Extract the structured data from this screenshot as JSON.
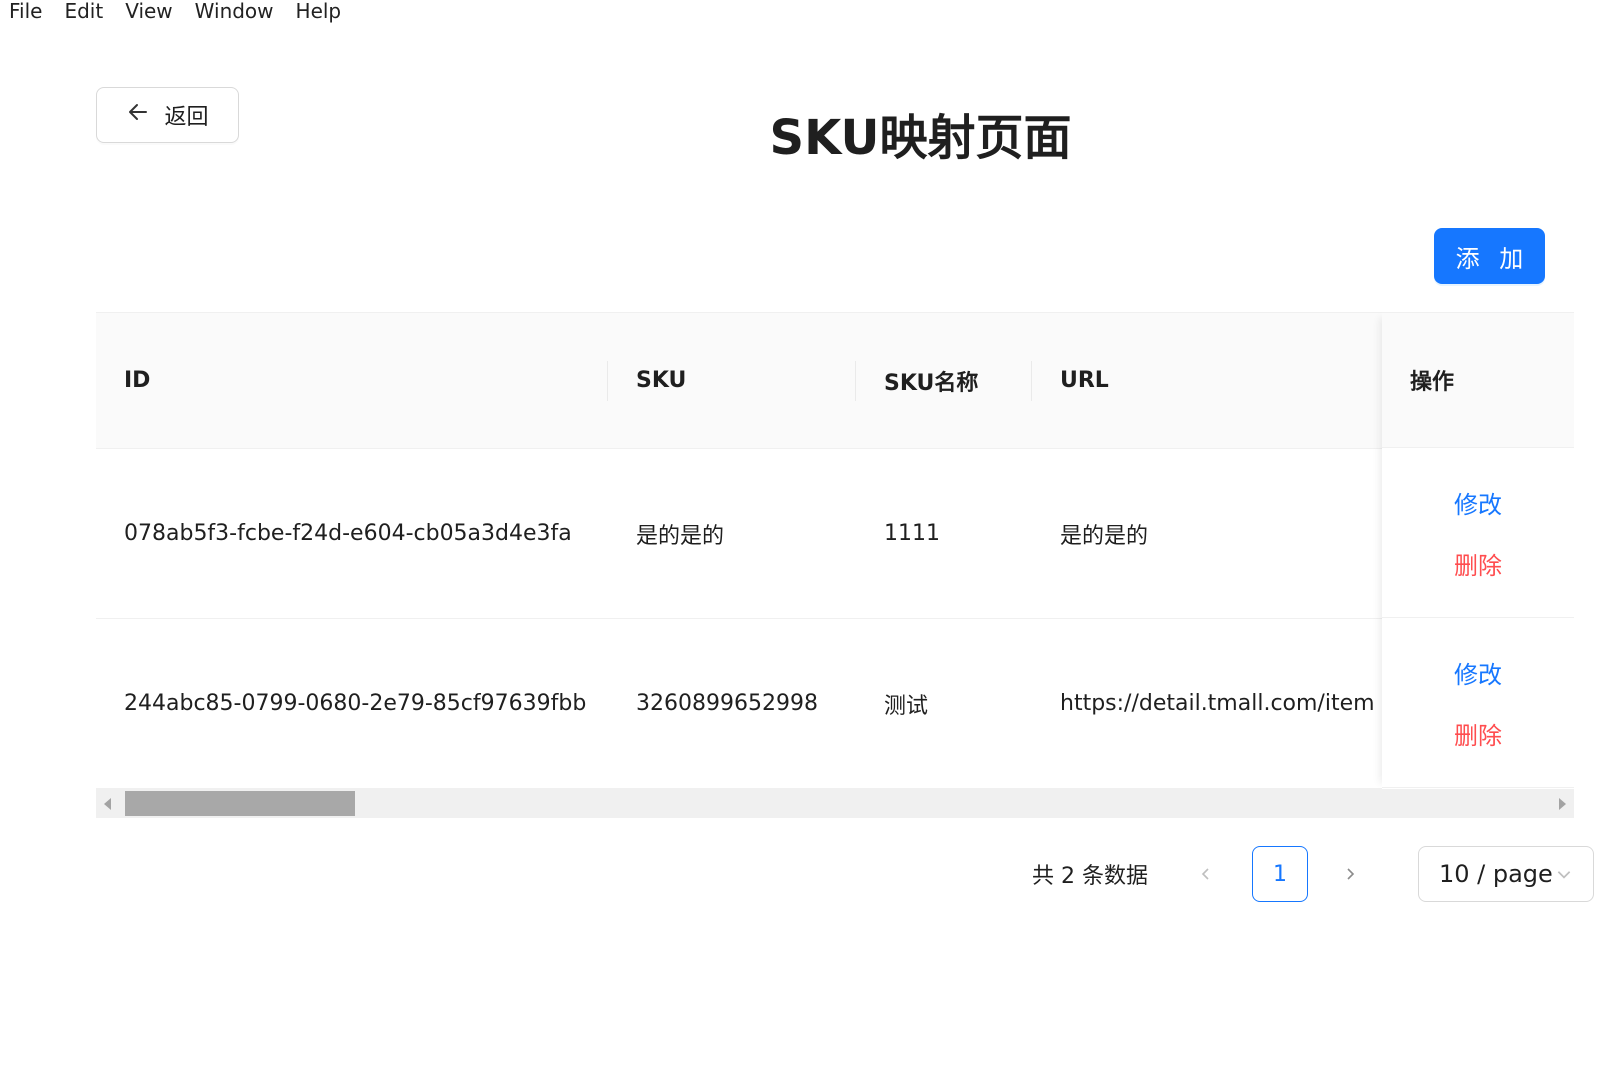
{
  "menubar": {
    "items": [
      "File",
      "Edit",
      "View",
      "Window",
      "Help"
    ]
  },
  "header": {
    "back_label": "返回",
    "title": "SKU映射页面"
  },
  "toolbar": {
    "add_label": "添 加"
  },
  "table": {
    "columns": [
      "ID",
      "SKU",
      "SKU名称",
      "URL",
      "操作"
    ],
    "rows": [
      {
        "id": "078ab5f3-fcbe-f24d-e604-cb05a3d4e3fa",
        "sku": "是的是的",
        "sku_name": "1111",
        "url": "是的是的",
        "edit_label": "修改",
        "delete_label": "删除"
      },
      {
        "id": "244abc85-0799-0680-2e79-85cf97639fbb",
        "sku": "3260899652998",
        "sku_name": "测试",
        "url": "https://detail.tmall.com/item",
        "edit_label": "修改",
        "delete_label": "删除"
      }
    ]
  },
  "pagination": {
    "total_text": "共 2 条数据",
    "current_page": "1",
    "page_size": "10 / page"
  },
  "colors": {
    "primary": "#1677ff",
    "danger": "#ff4d4f"
  }
}
